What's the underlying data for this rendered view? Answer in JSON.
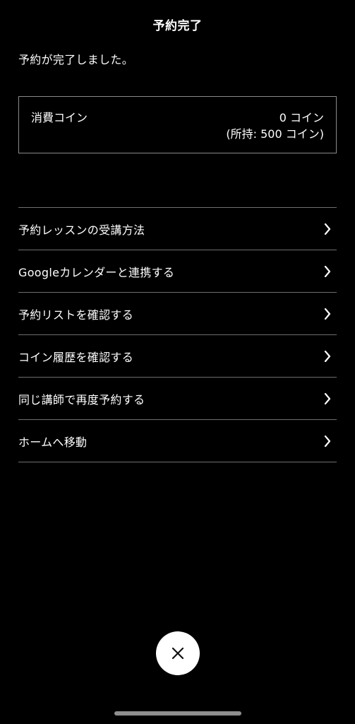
{
  "header": {
    "title": "予約完了"
  },
  "message": "予約が完了しました。",
  "coins": {
    "label": "消費コイン",
    "consumed": "0 コイン",
    "held": "(所持: 500 コイン)"
  },
  "menu": {
    "items": [
      {
        "label": "予約レッスンの受講方法",
        "icon": "chevron-right-icon"
      },
      {
        "label": "Googleカレンダーと連携する",
        "icon": "chevron-right-icon"
      },
      {
        "label": "予約リストを確認する",
        "icon": "chevron-right-icon"
      },
      {
        "label": "コイン履歴を確認する",
        "icon": "chevron-right-icon"
      },
      {
        "label": "同じ講師で再度予約する",
        "icon": "chevron-right-icon"
      },
      {
        "label": "ホームへ移動",
        "icon": "chevron-right-icon"
      }
    ]
  },
  "close": {
    "icon": "close-icon"
  },
  "colors": {
    "background": "#000000",
    "text": "#ffffff",
    "divider": "#6e6e6e",
    "button": "#ffffff"
  }
}
